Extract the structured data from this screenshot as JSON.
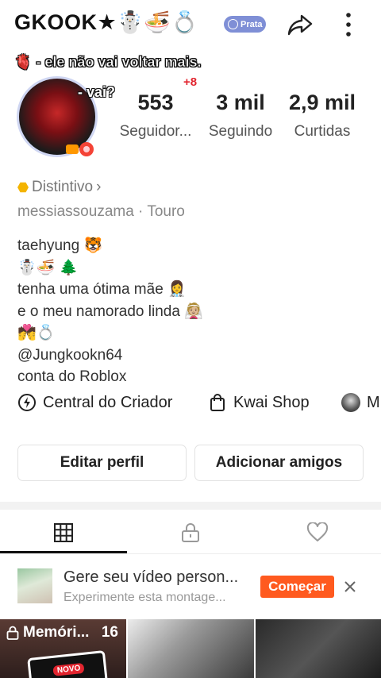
{
  "profile": {
    "username": "GKOOK★☃️🍜💍",
    "tier_badge": "Prata",
    "banner_line1": "🫀 - ele não vai voltar mais.",
    "banner_line2": "- vai?",
    "notification_count": "+8"
  },
  "stats": [
    {
      "value": "553",
      "label": "Seguidor..."
    },
    {
      "value": "3 mil",
      "label": "Seguindo"
    },
    {
      "value": "2,9 mil",
      "label": "Curtidas"
    }
  ],
  "distintivo_label": "Distintivo",
  "distintivo_chevron": "›",
  "meta_line": "messiassouzama · Touro",
  "bio": [
    "taehyung 🐯",
    "☃️🍜 🌲",
    "tenha uma ótima mãe 👩‍⚕️",
    "e o meu namorado linda 👰🏼",
    "💏💍",
    "@Jungkookn64",
    "conta do Roblox"
  ],
  "links": {
    "creator_center": "Central do Criador",
    "kwai_shop": "Kwai Shop",
    "third": "M"
  },
  "buttons": {
    "edit_profile": "Editar perfil",
    "add_friends": "Adicionar amigos"
  },
  "promo": {
    "title": "Gere seu vídeo person...",
    "subtitle": "Experimente esta montage...",
    "cta": "Começar"
  },
  "grid": {
    "memories_label": "Memóri...",
    "memories_count": "16",
    "novo_tag": "NOVO"
  },
  "colors": {
    "accent": "#ff5a1f",
    "badge": "#7f8fd6",
    "notification": "#e2252f"
  }
}
